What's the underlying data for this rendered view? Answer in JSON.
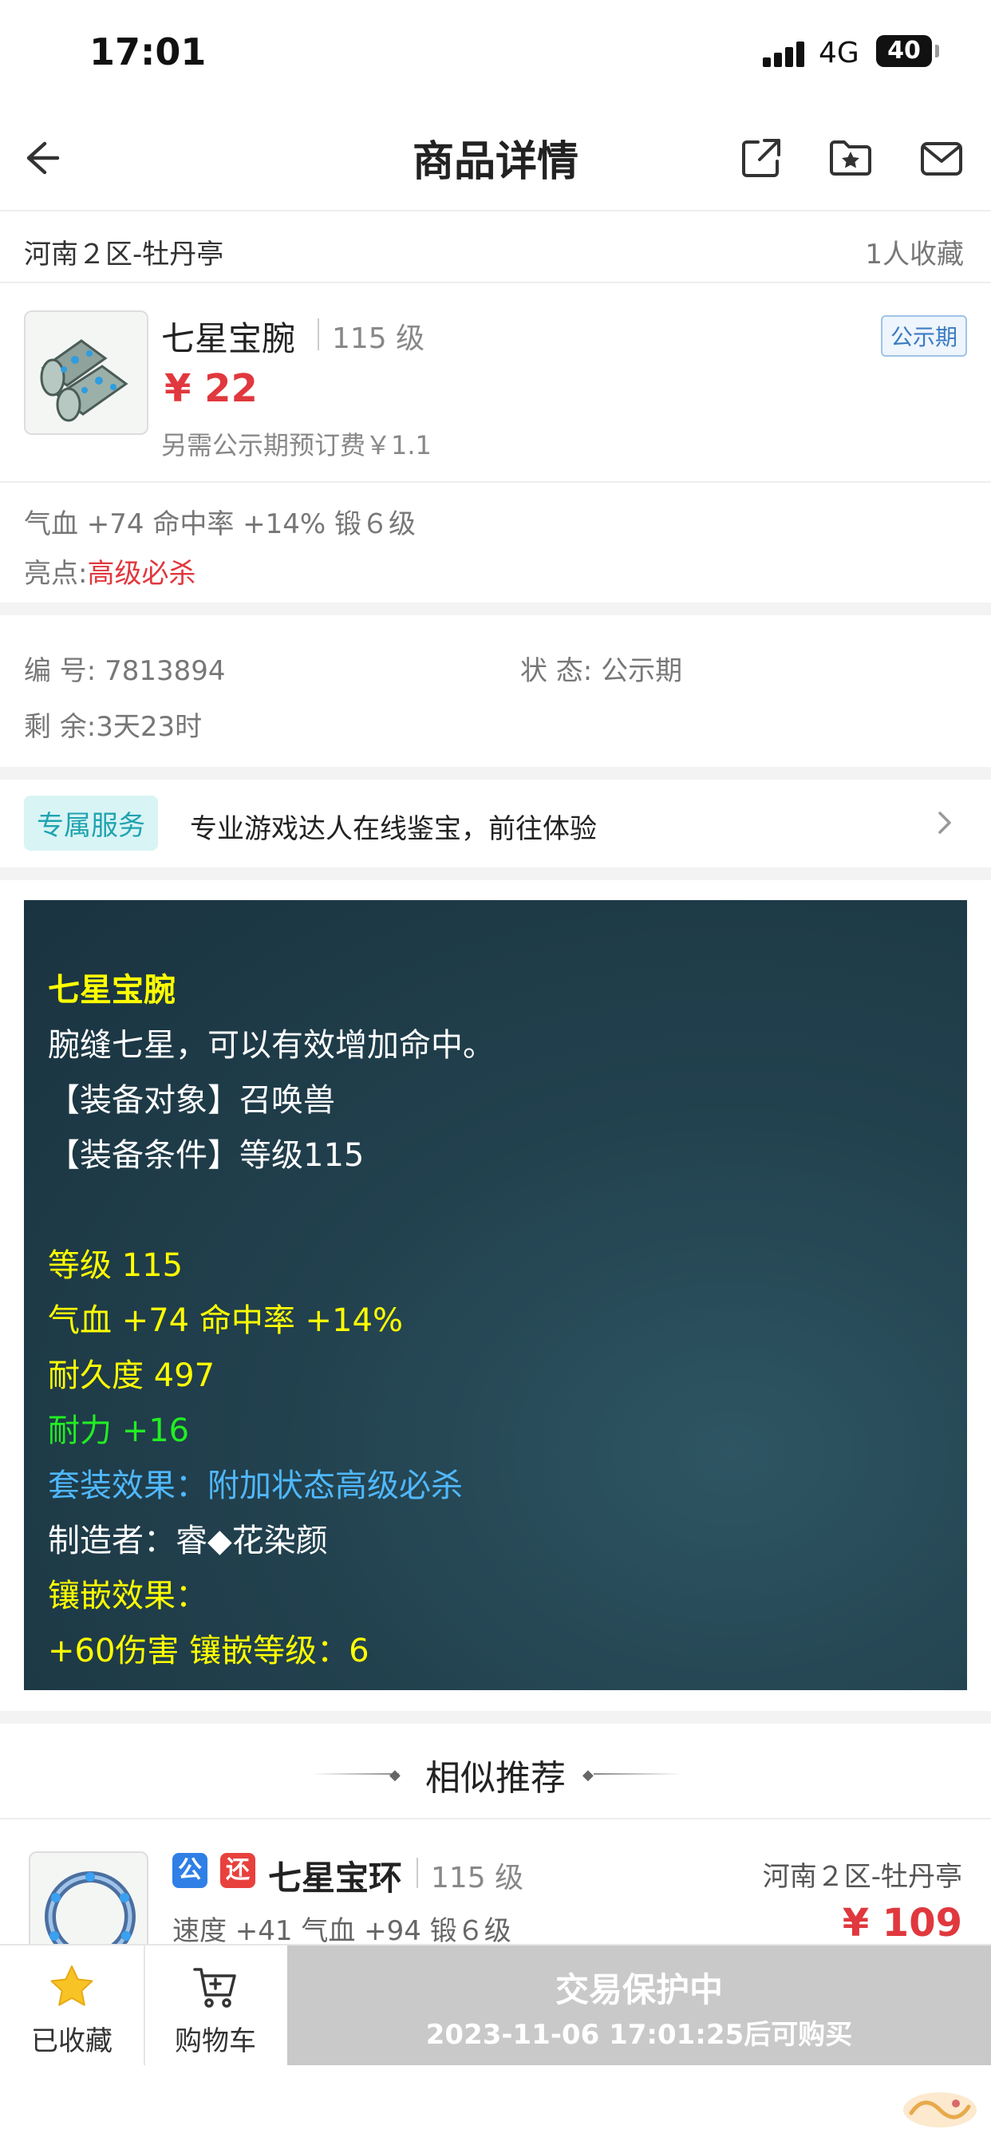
{
  "status": {
    "time": "17:01",
    "network": "4G",
    "battery": "40"
  },
  "nav": {
    "title": "商品详情"
  },
  "region": {
    "name": "河南２区-牡丹亭",
    "fav_count": "1人收藏"
  },
  "product": {
    "name": "七星宝腕",
    "level": "115 级",
    "price": "¥ 22",
    "fee": "另需公示期预订费￥1.1",
    "badge": "公示期",
    "attrs": "气血 +74 命中率 +14% 锻６级",
    "highlight_label": "亮点:",
    "highlight_value": "高级必杀"
  },
  "info": {
    "id_label": "编 号:",
    "id_value": "7813894",
    "status_label": "状 态:",
    "status_value": "公示期",
    "remain_label": "剩 余:",
    "remain_value": "3天23时"
  },
  "service": {
    "tag": "专属服务",
    "text": "专业游戏达人在线鉴宝，前往体验"
  },
  "description": {
    "lines": [
      "七星宝腕",
      "腕缝七星，可以有效增加命中。",
      "【装备对象】召唤兽",
      "【装备条件】等级115",
      "等级 115",
      "气血 +74 命中率 +14%",
      "耐久度 497",
      "耐力 +16",
      "套装效果：附加状态高级必杀",
      "制造者：睿◆花染颜",
      "镶嵌效果：",
      "+60伤害 镶嵌等级：6"
    ]
  },
  "similar": {
    "title": "相似推荐",
    "item": {
      "badge1": "公",
      "badge2": "还",
      "name": "七星宝环",
      "level": "115 级",
      "region": "河南２区-牡丹亭",
      "attrs": "速度 +41 气血 +94 锻６级",
      "price": "¥ 109"
    }
  },
  "bottom": {
    "fav_label": "已收藏",
    "cart_label": "购物车",
    "protect_title": "交易保护中",
    "protect_sub": "2023-11-06 17:01:25后可购买"
  },
  "colors": {
    "price_red": "#e0383e",
    "desc_yellow": "#ffff00",
    "desc_green": "#22ee22",
    "desc_blue": "#4fb8ff",
    "service_teal": "#1fa3b0",
    "star_gold": "#f7c325",
    "protect_gray": "#c9c9c9"
  },
  "icons": {
    "back": "back-arrow-icon",
    "share": "share-icon",
    "collect": "folder-star-icon",
    "message": "mail-icon",
    "chevron": "chevron-right-icon",
    "fav": "star-icon",
    "cart": "cart-icon"
  }
}
